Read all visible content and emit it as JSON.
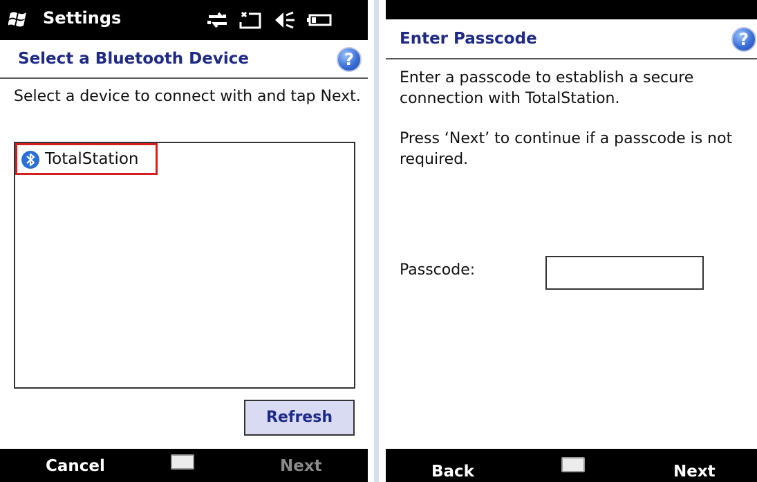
{
  "left": {
    "titlebar": {
      "title": "Settings"
    },
    "header": {
      "title": "Select a Bluetooth Device",
      "help": "?"
    },
    "instruction": "Select a device to connect with and tap Next.",
    "devices": [
      {
        "label": "TotalStation"
      }
    ],
    "refresh_label": "Refresh",
    "softkeys": {
      "left": "Cancel",
      "right": "Next"
    }
  },
  "right": {
    "header": {
      "title": "Enter Passcode",
      "help": "?"
    },
    "para1": "Enter a passcode to establish a secure connection with TotalStation.",
    "para2": "Press ‘Next’ to continue if a passcode is not required.",
    "passcode": {
      "label": "Passcode:",
      "value": ""
    },
    "softkeys": {
      "left": "Back",
      "right": "Next"
    }
  },
  "icons": {
    "start": "windows-flag-icon",
    "status": [
      "connectivity-icon",
      "no-signal-icon",
      "volume-icon",
      "battery-icon"
    ],
    "keyboard": "keyboard-icon",
    "bluetooth": "bluetooth-icon"
  },
  "colors": {
    "header_text": "#1e2a86",
    "help_blue": "#3b6fd8",
    "highlight_red": "#d21f1f",
    "refresh_bg": "#d9dbf2"
  }
}
